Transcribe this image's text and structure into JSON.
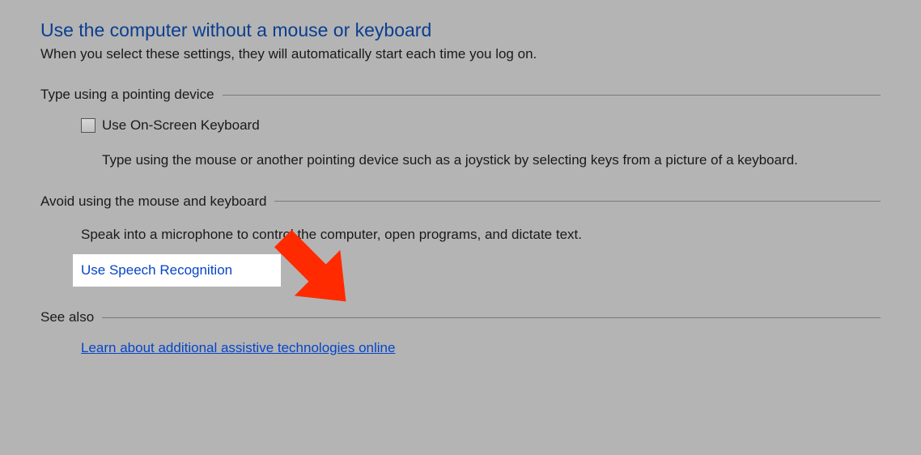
{
  "header": {
    "title": "Use the computer without a mouse or keyboard",
    "subtitle": "When you select these settings, they will automatically start each time you log on."
  },
  "sections": {
    "pointing": {
      "title": "Type using a pointing device",
      "checkbox_label": "Use On-Screen Keyboard",
      "description": "Type using the mouse or another pointing device such as a joystick by selecting keys from a picture of a keyboard."
    },
    "avoid": {
      "title": "Avoid using the mouse and keyboard",
      "description": "Speak into a microphone to control the computer, open programs, and dictate text.",
      "link_label": "Use Speech Recognition"
    },
    "see_also": {
      "title": "See also",
      "link_label": "Learn about additional assistive technologies online"
    }
  },
  "colors": {
    "heading": "#0a3e8f",
    "link": "#0645c9",
    "arrow": "#ff2a00"
  }
}
